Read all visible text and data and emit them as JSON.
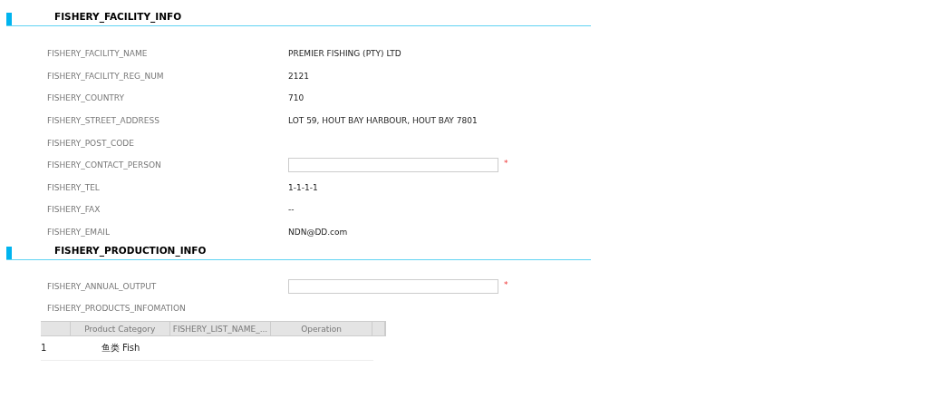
{
  "sections": [
    {
      "title": "FISHERY_FACILITY_INFO",
      "fields": [
        {
          "kind": "text",
          "label": "FISHERY_FACILITY_NAME",
          "value": "PREMIER FISHING (PTY) LTD"
        },
        {
          "kind": "text",
          "label": "FISHERY_FACILITY_REG_NUM",
          "value": "2121"
        },
        {
          "kind": "text",
          "label": "FISHERY_COUNTRY",
          "value": "710"
        },
        {
          "kind": "text",
          "label": "FISHERY_STREET_ADDRESS",
          "value": "LOT 59, HOUT BAY HARBOUR, HOUT BAY 7801"
        },
        {
          "kind": "text",
          "label": "FISHERY_POST_CODE"
        },
        {
          "kind": "input",
          "label": "FISHERY_CONTACT_PERSON",
          "required_mark": "*"
        },
        {
          "kind": "text",
          "label": "FISHERY_TEL",
          "value": "1-1-1-1"
        },
        {
          "kind": "text",
          "label": "FISHERY_FAX",
          "value": "--"
        },
        {
          "kind": "text",
          "label": "FISHERY_EMAIL",
          "value": "NDN@DD.com"
        }
      ]
    },
    {
      "title": "FISHERY_PRODUCTION_INFO",
      "fields": [
        {
          "kind": "input",
          "label": "FISHERY_ANNUAL_OUTPUT",
          "required_mark": "*"
        },
        {
          "kind": "text",
          "label": "FISHERY_PRODUCTS_INFOMATION"
        }
      ],
      "table": {
        "columns": [
          "Product Category",
          "FISHERY_LIST_NAME_...",
          "Operation"
        ],
        "rows": [
          {
            "number": "1",
            "cells": [
              "鱼类 Fish"
            ]
          }
        ]
      }
    }
  ]
}
